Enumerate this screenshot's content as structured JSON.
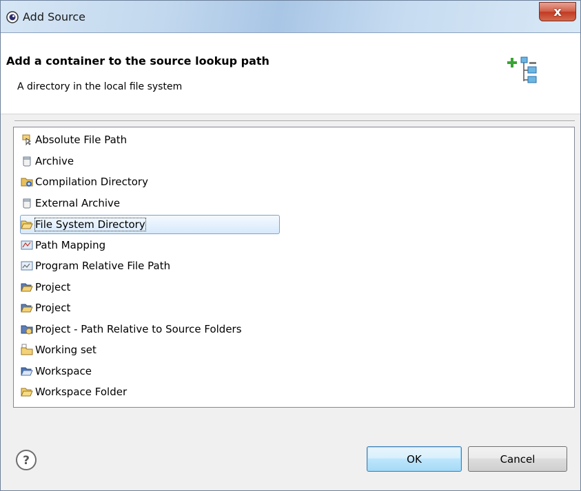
{
  "window": {
    "title": "Add Source"
  },
  "header": {
    "title": "Add a container to the source lookup path",
    "description": "A directory in the local file system"
  },
  "list": {
    "items": [
      {
        "label": "Absolute File Path",
        "icon": "absolute-path-icon"
      },
      {
        "label": "Archive",
        "icon": "archive-jar-icon"
      },
      {
        "label": "Compilation Directory",
        "icon": "compilation-folder-icon"
      },
      {
        "label": "External Archive",
        "icon": "archive-jar-icon"
      },
      {
        "label": "File System Directory",
        "icon": "open-folder-icon",
        "selected": true
      },
      {
        "label": "Path Mapping",
        "icon": "path-mapping-icon"
      },
      {
        "label": "Program Relative File Path",
        "icon": "program-relative-icon"
      },
      {
        "label": "Project",
        "icon": "project-folder-icon"
      },
      {
        "label": "Project",
        "icon": "project-folder-icon"
      },
      {
        "label": "Project - Path Relative to Source Folders",
        "icon": "project-relative-folder-icon"
      },
      {
        "label": "Working set",
        "icon": "working-set-icon"
      },
      {
        "label": "Workspace",
        "icon": "workspace-folder-icon"
      },
      {
        "label": "Workspace Folder",
        "icon": "open-folder-icon"
      }
    ]
  },
  "buttons": {
    "ok": "OK",
    "cancel": "Cancel",
    "help": "?",
    "close": "x"
  },
  "colors": {
    "selection_border": "#7da2ce",
    "ok_border": "#3c7fb1",
    "close_red": "#c23a23"
  }
}
